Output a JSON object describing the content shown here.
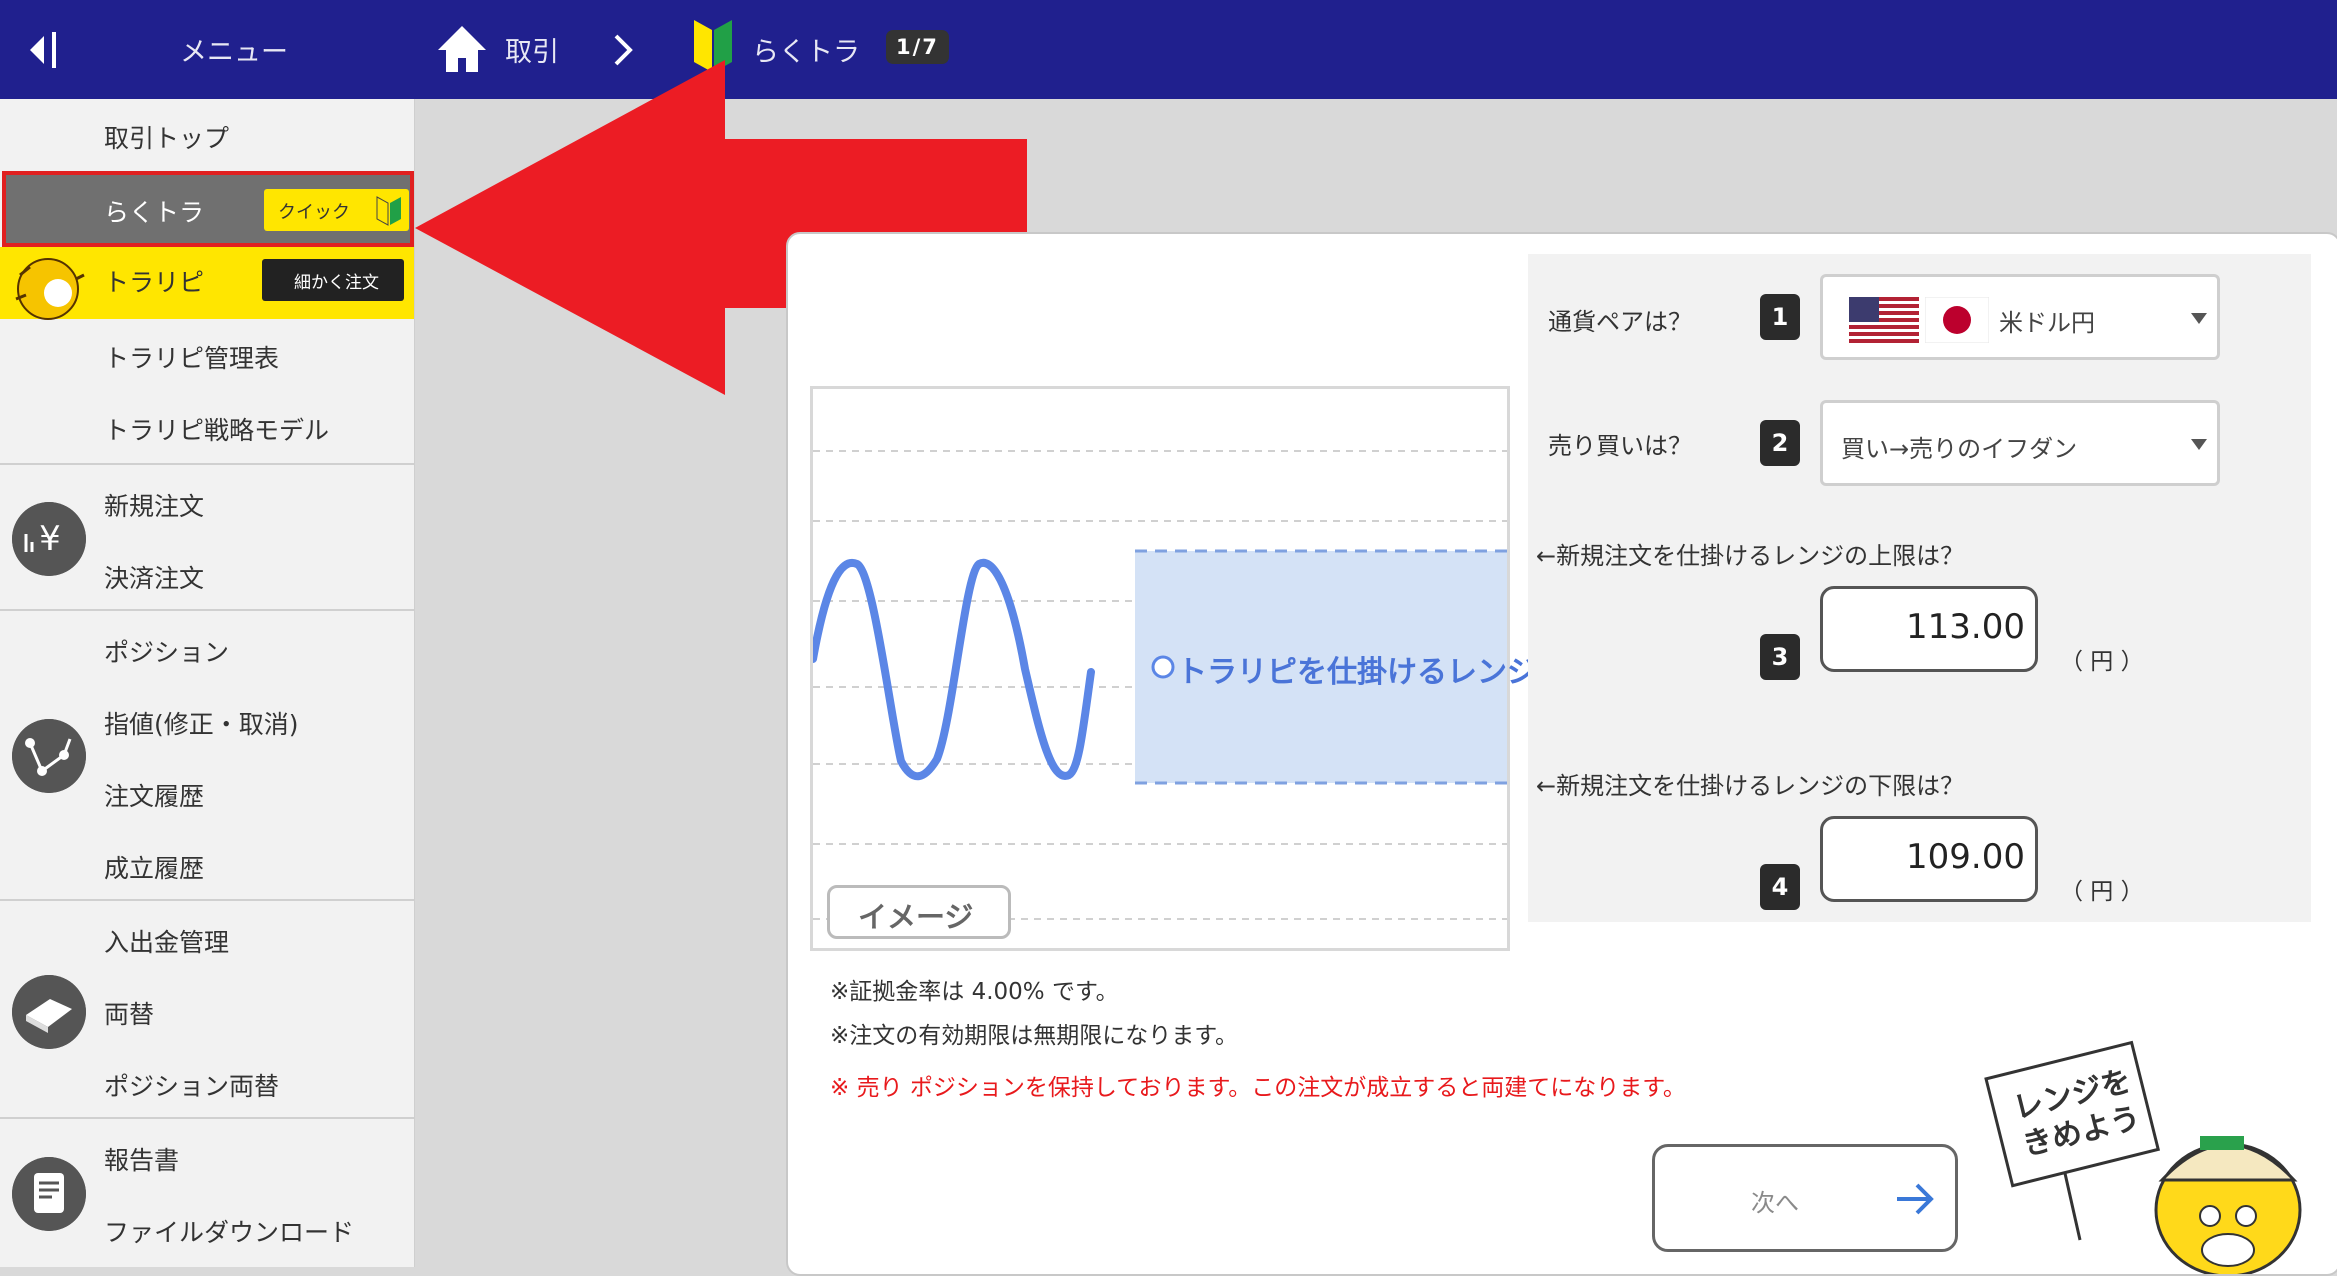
{
  "header": {
    "menu_label": "メニュー",
    "trade_label": "取引",
    "current_label": "らくトラ",
    "step_indicator": "1/7"
  },
  "sidebar": {
    "items": [
      {
        "label": "取引トップ"
      },
      {
        "label": "らくトラ",
        "badge": "クイック"
      },
      {
        "label": "トラリピ",
        "badge": "細かく注文"
      },
      {
        "label": "トラリピ管理表"
      },
      {
        "label": "トラリピ戦略モデル"
      },
      {
        "label": "新規注文"
      },
      {
        "label": "決済注文"
      },
      {
        "label": "ポジション"
      },
      {
        "label": "指値(修正・取消)"
      },
      {
        "label": "注文履歴"
      },
      {
        "label": "成立履歴"
      },
      {
        "label": "入出金管理"
      },
      {
        "label": "両替"
      },
      {
        "label": "ポジション両替"
      },
      {
        "label": "報告書"
      },
      {
        "label": "ファイルダウンロード"
      }
    ]
  },
  "chart": {
    "range_label": "トラリピを仕掛けるレンジ",
    "image_tag": "イメージ"
  },
  "form": {
    "pair_question": "通貨ペアは？",
    "pair_value": "米ドル円",
    "side_question": "売り買いは？",
    "side_value": "買い→売りのイフダン",
    "upper_question": "←新規注文を仕掛けるレンジの上限は？",
    "upper_value": "113.00",
    "lower_question": "←新規注文を仕掛けるレンジの下限は？",
    "lower_value": "109.00",
    "unit": "（ 円 ）",
    "steps": [
      "1",
      "2",
      "3",
      "4"
    ]
  },
  "notes": {
    "margin_note": "※証拠金率は 4.00%  です。",
    "expiry_note": "※注文の有効期限は無期限になります。",
    "warning": "※ 売り ポジションを保持しております。この注文が成立すると両建てになります。"
  },
  "next_button": "次へ",
  "mascot_sign": [
    "レンジを",
    "きめよう"
  ],
  "colors": {
    "header_bg": "#20208e",
    "accent_yellow": "#ffe600",
    "arrow_red": "#ec1c24",
    "range_fill": "#d4e2f6",
    "wave_blue": "#5b86e6",
    "warning_red": "#e8191c"
  },
  "icons": [
    "back-icon",
    "home-icon",
    "chevron-right-icon",
    "beginner-leaf-icon",
    "yen-chart-icon",
    "order-nodes-icon",
    "money-exchange-icon",
    "document-icon",
    "us-flag-icon",
    "jp-flag-icon",
    "arrow-right-icon"
  ]
}
